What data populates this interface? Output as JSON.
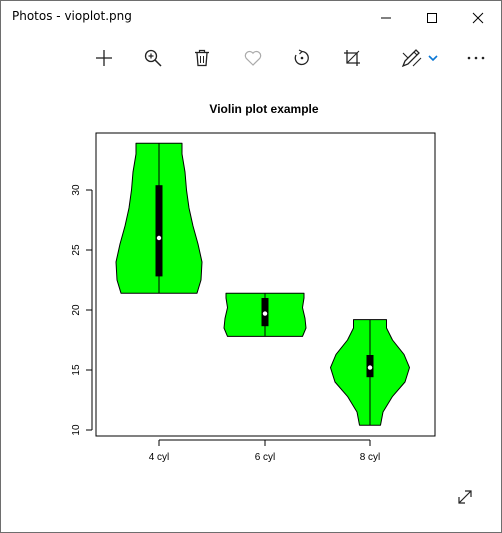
{
  "window": {
    "title": "Photos - vioplot.png"
  },
  "toolbar": {
    "tools": [
      {
        "name": "photos-app",
        "icon": "image-icon"
      },
      {
        "name": "add",
        "icon": "plus-icon"
      },
      {
        "name": "zoom",
        "icon": "zoom-in-icon"
      },
      {
        "name": "delete",
        "icon": "trash-icon"
      },
      {
        "name": "favorite",
        "icon": "heart-icon"
      },
      {
        "name": "rotate",
        "icon": "rotate-icon"
      },
      {
        "name": "crop",
        "icon": "crop-icon"
      },
      {
        "name": "edit",
        "icon": "edit-draw-icon"
      },
      {
        "name": "more",
        "icon": "more-icon"
      }
    ],
    "accent": "#0a77d5"
  },
  "chart_data": {
    "type": "violin",
    "title": "Violin plot example",
    "xlabel": "",
    "ylabel": "",
    "categories": [
      "4 cyl",
      "6 cyl",
      "8 cyl"
    ],
    "ylim": [
      10,
      34.5
    ],
    "yticks": [
      10,
      15,
      20,
      25,
      30
    ],
    "fill": "#00ff00",
    "groups": [
      {
        "name": "4 cyl",
        "min": 21.4,
        "q1": 22.8,
        "median": 26.0,
        "q3": 30.4,
        "max": 33.9,
        "density": [
          [
            21.4,
            0.76
          ],
          [
            22.5,
            0.84
          ],
          [
            24,
            0.86
          ],
          [
            25.5,
            0.78
          ],
          [
            27,
            0.68
          ],
          [
            28.5,
            0.6
          ],
          [
            30,
            0.55
          ],
          [
            31.5,
            0.52
          ],
          [
            33,
            0.46
          ],
          [
            33.9,
            0.46
          ]
        ]
      },
      {
        "name": "6 cyl",
        "min": 17.8,
        "q1": 18.65,
        "median": 19.7,
        "q3": 21.0,
        "max": 21.4,
        "density": [
          [
            17.8,
            0.75
          ],
          [
            18.5,
            0.82
          ],
          [
            19.3,
            0.8
          ],
          [
            20.2,
            0.75
          ],
          [
            21,
            0.78
          ],
          [
            21.4,
            0.78
          ]
        ]
      },
      {
        "name": "8 cyl",
        "min": 10.4,
        "q1": 14.4,
        "median": 15.2,
        "q3": 16.25,
        "max": 19.2,
        "density": [
          [
            10.4,
            0.21
          ],
          [
            11.5,
            0.26
          ],
          [
            12.8,
            0.45
          ],
          [
            14,
            0.7
          ],
          [
            15.2,
            0.79
          ],
          [
            16.3,
            0.68
          ],
          [
            17.5,
            0.45
          ],
          [
            18.5,
            0.33
          ],
          [
            19.2,
            0.33
          ]
        ]
      }
    ]
  }
}
